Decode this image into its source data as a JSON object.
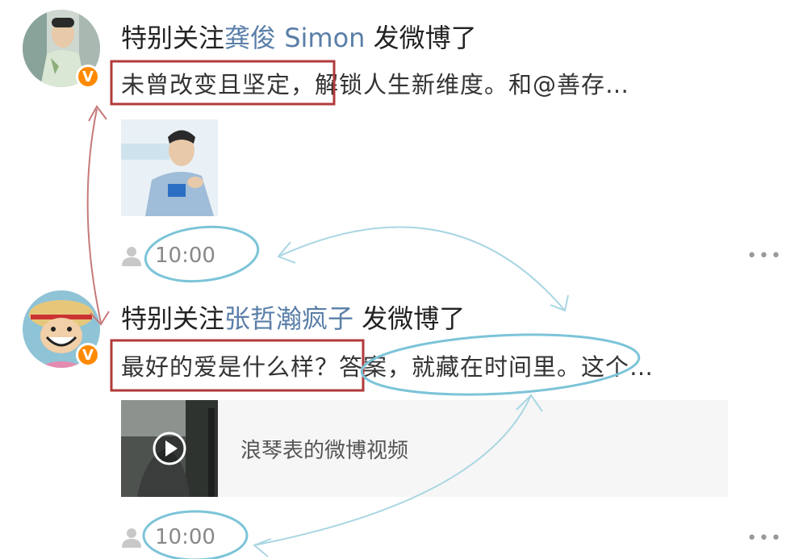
{
  "posts": [
    {
      "prefix": "特别关注",
      "user": "龚俊 Simon",
      "suffix": " 发微博了",
      "text": "未曾改变且坚定，解锁人生新维度。和@善存…",
      "time": "10:00",
      "more": "•••",
      "verified_badge": "V"
    },
    {
      "prefix": "特别关注",
      "user": "张哲瀚疯子",
      "suffix": " 发微博了",
      "text": "最好的爱是什么样？答案，就藏在时间里。这个…",
      "time": "10:00",
      "more": "•••",
      "verified_badge": "V",
      "video_label": "浪琴表的微博视频"
    }
  ],
  "colors": {
    "user_link": "#5a7fa8",
    "annotation_red": "#b23a3a",
    "annotation_blue": "#7cc4d8",
    "badge_orange": "#ff8a00"
  }
}
